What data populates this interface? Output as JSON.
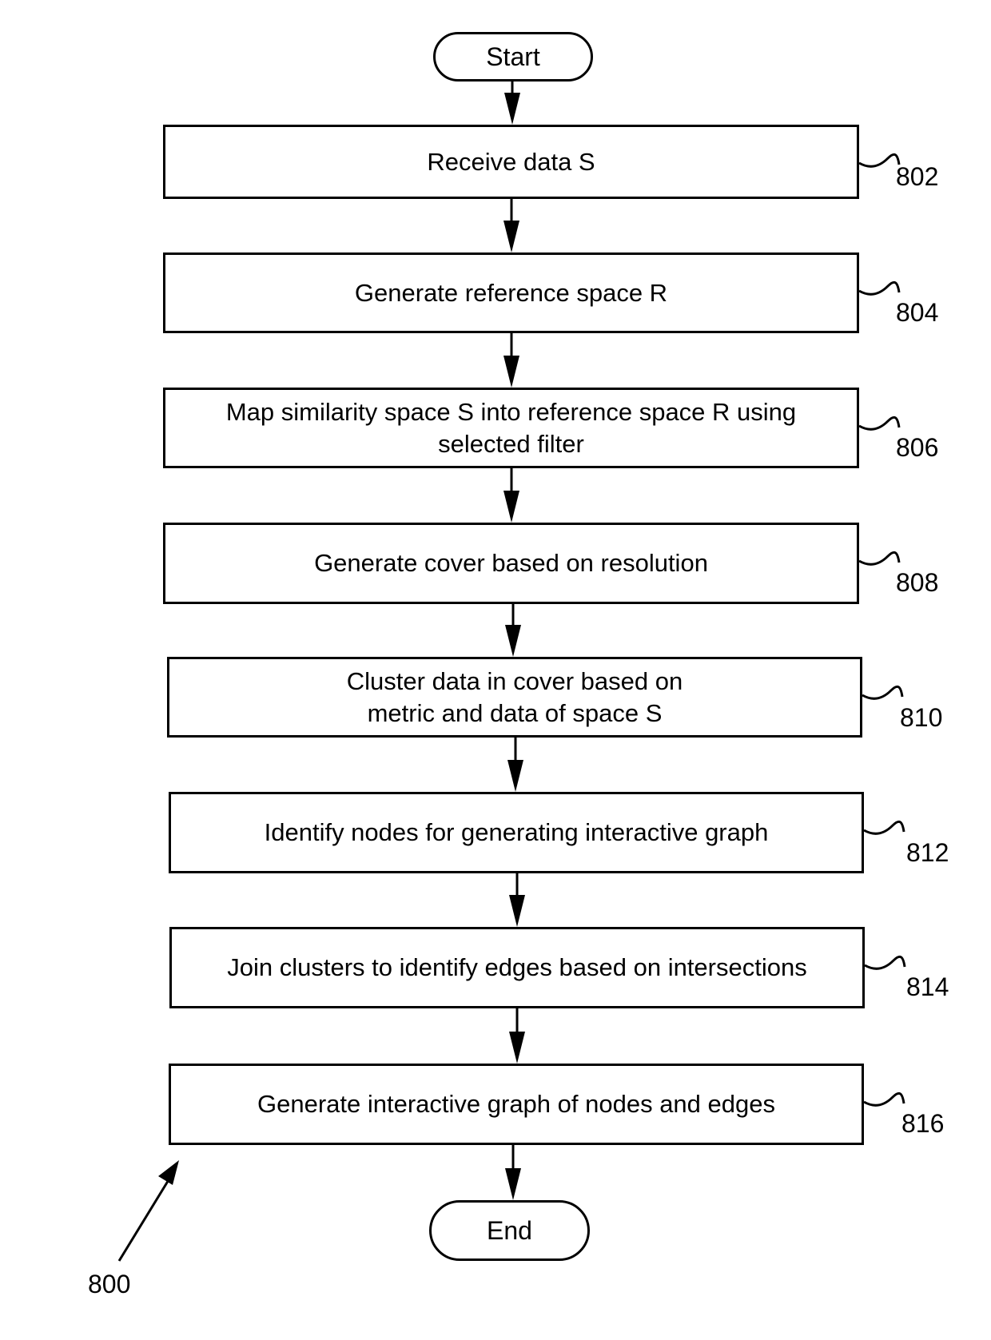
{
  "diagram": {
    "figure_ref": "800",
    "start": {
      "label": "Start"
    },
    "end": {
      "label": "End"
    },
    "steps": [
      {
        "ref": "802",
        "label": "Receive data S"
      },
      {
        "ref": "804",
        "label": "Generate reference space R"
      },
      {
        "ref": "806",
        "label": "Map similarity space S into reference space R using selected filter"
      },
      {
        "ref": "808",
        "label": "Generate cover based on resolution"
      },
      {
        "ref": "810",
        "label": "Cluster data in cover based on metric and data of space S"
      },
      {
        "ref": "812",
        "label": "Identify nodes for generating interactive graph"
      },
      {
        "ref": "814",
        "label": "Join clusters to identify edges based on intersections"
      },
      {
        "ref": "816",
        "label": "Generate interactive graph of nodes and edges"
      }
    ],
    "edges": [
      [
        "start",
        "802"
      ],
      [
        "802",
        "804"
      ],
      [
        "804",
        "806"
      ],
      [
        "806",
        "808"
      ],
      [
        "808",
        "810"
      ],
      [
        "810",
        "812"
      ],
      [
        "812",
        "814"
      ],
      [
        "814",
        "816"
      ],
      [
        "816",
        "end"
      ]
    ]
  }
}
